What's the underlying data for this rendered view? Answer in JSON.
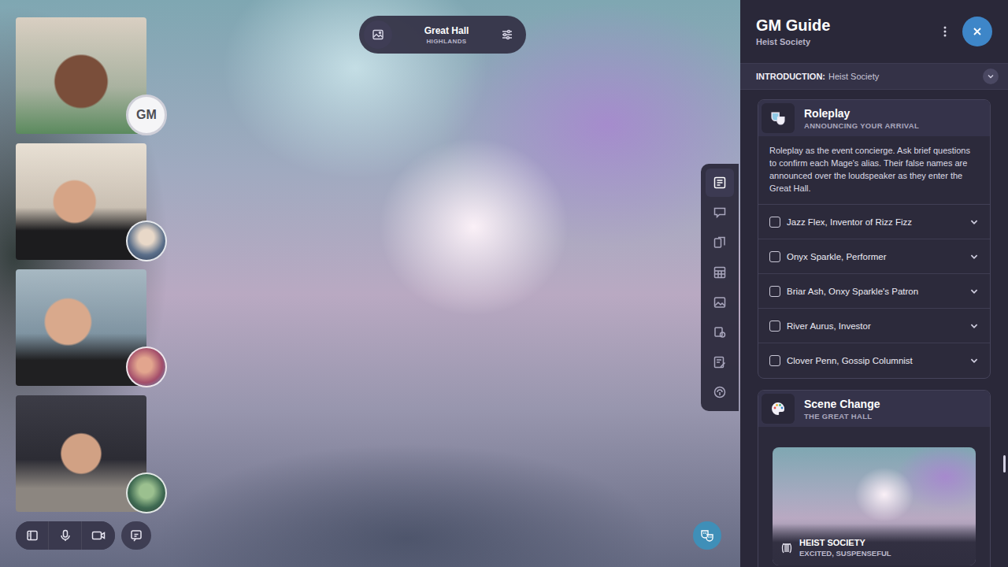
{
  "scene": {
    "title": "Great Hall",
    "subtitle": "HIGHLANDS"
  },
  "participants": [
    {
      "kind": "gm",
      "badge": "GM"
    },
    {
      "kind": "player"
    },
    {
      "kind": "player"
    },
    {
      "kind": "player"
    }
  ],
  "tools": [
    {
      "selected": true
    },
    {
      "selected": false
    },
    {
      "selected": false
    },
    {
      "selected": false
    },
    {
      "selected": false
    },
    {
      "selected": false
    },
    {
      "selected": false
    },
    {
      "selected": false
    }
  ],
  "panel": {
    "title": "GM Guide",
    "subtitle": "Heist Society",
    "section": {
      "label": "INTRODUCTION:",
      "value": "Heist Society"
    }
  },
  "cards": [
    {
      "kind": "roleplay",
      "title": "Roleplay",
      "subtitle": "ANNOUNCING YOUR ARRIVAL",
      "description": "Roleplay as the event concierge. Ask brief questions to confirm each Mage's alias. Their false names are announced over the loudspeaker as they enter the Great Hall.",
      "checklist": [
        {
          "label": "Jazz Flex, Inventor of Rizz Fizz",
          "checked": false,
          "expanded": false
        },
        {
          "label": "Onyx Sparkle, Performer",
          "checked": false,
          "expanded": false
        },
        {
          "label": "Briar Ash, Onxy Sparkle's Patron",
          "checked": false,
          "expanded": false
        },
        {
          "label": "River Aurus, Investor",
          "checked": false,
          "expanded": false
        },
        {
          "label": "Clover Penn, Gossip Columnist",
          "checked": false,
          "expanded": false
        }
      ]
    },
    {
      "kind": "scene",
      "title": "Scene Change",
      "subtitle": "THE GREAT HALL",
      "scene": {
        "title": "HEIST SOCIETY",
        "mood": "EXCITED, SUSPENSEFUL"
      }
    }
  ]
}
